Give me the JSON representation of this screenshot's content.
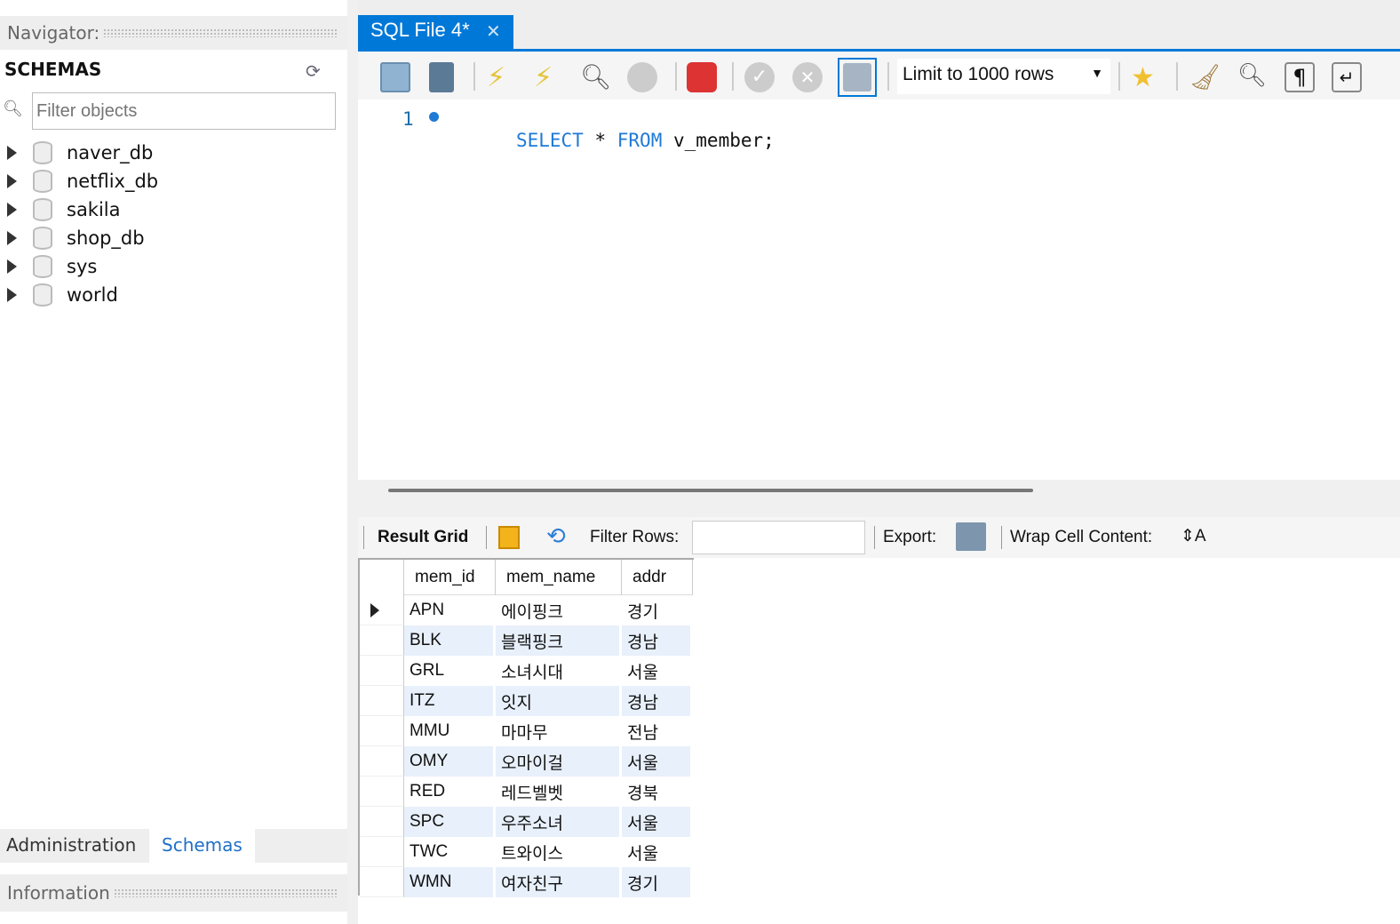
{
  "navigator": {
    "title": "Navigator:",
    "schemas_label": "SCHEMAS",
    "filter_placeholder": "Filter objects",
    "schemas": [
      "naver_db",
      "netflix_db",
      "sakila",
      "shop_db",
      "sys",
      "world"
    ],
    "bottom_tabs": [
      "Administration",
      "Schemas"
    ],
    "info_title": "Information"
  },
  "editor": {
    "tab_title": "SQL File 4*",
    "limit": "Limit to 1000 rows",
    "line_number": "1",
    "sql": {
      "kw1": "SELECT",
      "star": "*",
      "kw2": "FROM",
      "ident": "v_member;"
    }
  },
  "results": {
    "result_grid": "Result Grid",
    "filter_rows": "Filter Rows:",
    "filter_value": "",
    "export": "Export:",
    "wrap": "Wrap Cell Content:",
    "columns": [
      "mem_id",
      "mem_name",
      "addr"
    ],
    "rows": [
      [
        "APN",
        "에이핑크",
        "경기"
      ],
      [
        "BLK",
        "블랙핑크",
        "경남"
      ],
      [
        "GRL",
        "소녀시대",
        "서울"
      ],
      [
        "ITZ",
        "잇지",
        "경남"
      ],
      [
        "MMU",
        "마마무",
        "전남"
      ],
      [
        "OMY",
        "오마이걸",
        "서울"
      ],
      [
        "RED",
        "레드벨벳",
        "경북"
      ],
      [
        "SPC",
        "우주소녀",
        "서울"
      ],
      [
        "TWC",
        "트와이스",
        "서울"
      ],
      [
        "WMN",
        "여자친구",
        "경기"
      ]
    ]
  },
  "colors": {
    "accent": "#0078d7",
    "keyword": "#1f7ad6",
    "alt_row": "#e8f0fb"
  }
}
